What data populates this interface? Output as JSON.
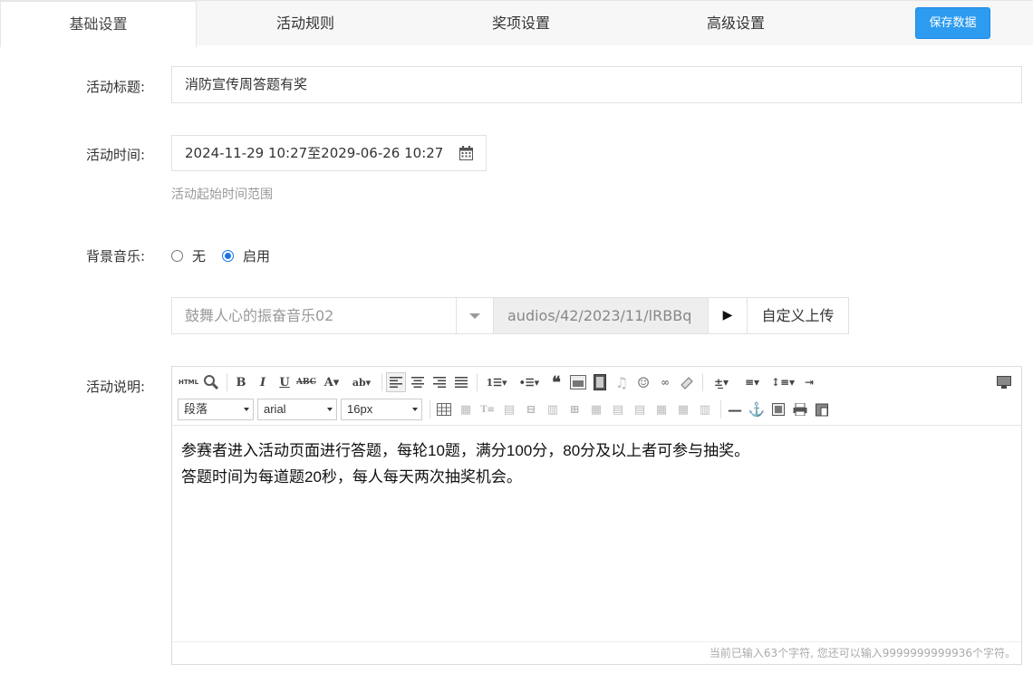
{
  "tabs": [
    {
      "label": "基础设置",
      "active": true
    },
    {
      "label": "活动规则",
      "active": false
    },
    {
      "label": "奖项设置",
      "active": false
    },
    {
      "label": "高级设置",
      "active": false
    }
  ],
  "save_button": "保存数据",
  "form": {
    "title_label": "活动标题:",
    "title_value": "消防宣传周答题有奖",
    "time_label": "活动时间:",
    "time_value": "2024-11-29 10:27至2029-06-26 10:27",
    "time_hint": "活动起始时间范围",
    "music_label": "背景音乐:",
    "music_options": [
      {
        "label": "无",
        "checked": false
      },
      {
        "label": "启用",
        "checked": true
      }
    ],
    "music_select": "鼓舞人心的振奋音乐02",
    "music_path": "audios/42/2023/11/lRBBq",
    "play_symbol": "▶",
    "upload_label": "自定义上传",
    "desc_label": "活动说明:"
  },
  "editor": {
    "paragraph_select": "段落",
    "font_select": "arial",
    "size_select": "16px",
    "html_label": "HTML",
    "content_lines": [
      "参赛者进入活动页面进行答题，每轮10题，满分100分，80分及以上者可参与抽奖。",
      "答题时间为每道题20秒，每人每天两次抽奖机会。"
    ],
    "counter": "当前已输入63个字符, 您还可以输入9999999999936个字符。"
  },
  "colors": {
    "accent": "#2d9bf0",
    "radio_checked": "#1a73e8"
  }
}
